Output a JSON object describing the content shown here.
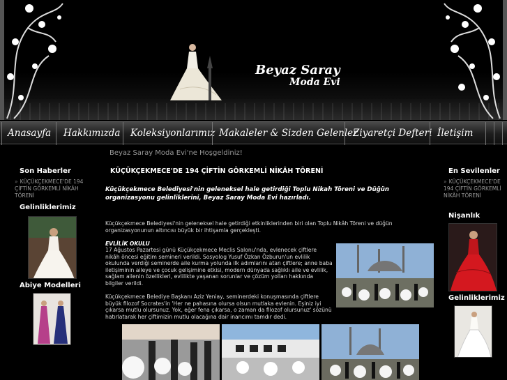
{
  "header": {
    "logo_line1": "Beyaz Saray",
    "logo_line2": "Moda Evi"
  },
  "nav": {
    "items": [
      "Anasayfa",
      "Hakkımızda",
      "Koleksiyonlarımız",
      "Makaleler & Sizden Gelenler",
      "Ziyaretçi Defteri",
      "İletişim"
    ]
  },
  "welcome": "Beyaz Saray Moda Evi'ne Hoşgeldiniz!",
  "left_sidebar": {
    "news_title": "Son Haberler",
    "news_link": "KÜÇÜKÇEKMECE'DE 194 ÇİFTİN GÖRKEMLİ NİKÂH TÖRENİ",
    "brides_title": "Gelinliklerimiz",
    "evening_title": "Abiye Modelleri"
  },
  "right_sidebar": {
    "favorites_title": "En Sevilenler",
    "favorites_link": "KÜÇÜKÇEKMECE'DE 194 ÇİFTİN GÖRKEMLİ NİKÂH TÖRENİ",
    "engagement_title": "Nişanlık",
    "brides_title": "Gelinliklerimiz"
  },
  "article": {
    "title": "KÜÇÜKÇEKMECE'DE 194 ÇİFTİN GÖRKEMLİ NİKÂH TÖRENİ",
    "lead": "Küçükçekmece Belediyesi'nin geleneksel hale getirdiği Toplu Nikah Töreni ve Düğün organizasyonu gelinliklerini, Beyaz Saray Moda Evi hazırladı.",
    "p1": "Küçükçekmece Belediyesi'nin geleneksel hale getirdiği etkinliklerinden biri olan Toplu Nikâh Töreni ve düğün organizasyonunun altıncısı büyük bir ihtişamla gerçekleşti.",
    "subheading": "EVLİLİK OKULU",
    "p2": "17 Ağustos Pazartesi günü Küçükçekmece Meclis Salonu'nda, evlenecek çiftlere nikâh öncesi eğitim semineri verildi. Sosyolog Yusuf Özkan Özburun'un evlilik okulunda verdiği seminerde aile kurma yolunda ilk adımlarını atan çiftlere; anne baba iletişiminin aileye ve çocuk gelişimine etkisi, modern dünyada sağlıklı aile ve evlilik, sağlam ailenin özellikleri, evlilikte yaşanan sorunlar ve çözüm yolları hakkında bilgiler verildi.",
    "p3": "Küçükçekmece Belediye Başkanı Aziz Yeniay, seminerdeki konuşmasında çiftlere büyük filozof Socrates'in 'Her ne pahasına olursa olsun mutlaka evlenin. Eşiniz iyi çıkarsa mutlu olursunuz. Yok, eğer fena çıkarsa, o zaman da filozof olursunuz' sözünü hatırlatarak her çiftimizin mutlu olacağına dair inancımı tamdır dedi."
  },
  "colors": {
    "background": "#000000",
    "muted_text": "#999999",
    "nav_text": "#ffffff"
  }
}
